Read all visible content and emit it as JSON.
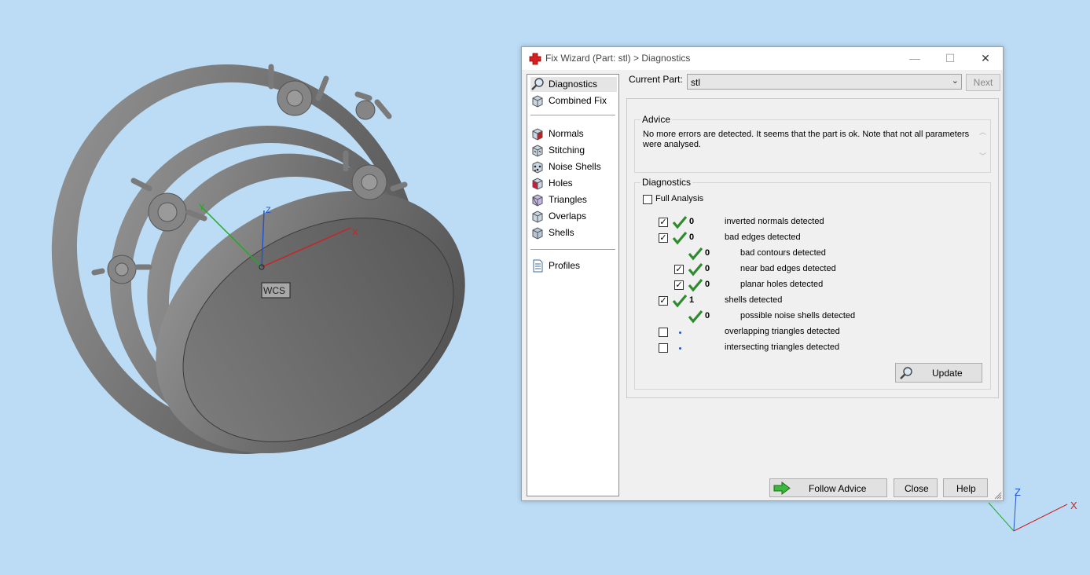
{
  "viewport": {
    "wcs_label": "WCS",
    "axis_x": "X",
    "axis_y": "Y",
    "axis_z": "Z"
  },
  "colors": {
    "background": "#bcdcf6",
    "check_green": "#2e8b2e",
    "axis_x": "#cc2222",
    "axis_y": "#22aa22",
    "axis_z": "#2255cc"
  },
  "dialog": {
    "title": "Fix Wizard (Part: stl) > Diagnostics",
    "title_icon": "red-cross-icon",
    "window_controls": {
      "minimize": "—",
      "maximize": "☐",
      "close": "✕"
    },
    "nav": {
      "top_items": [
        {
          "label": "Diagnostics",
          "icon": "magnifier-icon"
        },
        {
          "label": "Combined Fix",
          "icon": "cube-icon"
        }
      ],
      "fix_items": [
        {
          "label": "Normals",
          "icon": "normals-cube-icon"
        },
        {
          "label": "Stitching",
          "icon": "stitching-cube-icon"
        },
        {
          "label": "Noise Shells",
          "icon": "noise-shells-icon"
        },
        {
          "label": "Holes",
          "icon": "holes-cube-icon"
        },
        {
          "label": "Triangles",
          "icon": "triangles-cube-icon"
        },
        {
          "label": "Overlaps",
          "icon": "overlaps-cube-icon"
        },
        {
          "label": "Shells",
          "icon": "shells-cube-icon"
        }
      ],
      "bottom_items": [
        {
          "label": "Profiles",
          "icon": "document-icon"
        }
      ]
    },
    "current_part": {
      "label": "Current Part:",
      "value": "stl"
    },
    "next_label": "Next",
    "advice": {
      "title": "Advice",
      "text": "No more errors are detected. It seems that the part is ok. Note that not all parameters were analysed."
    },
    "diagnostics": {
      "title": "Diagnostics",
      "full_analysis": "Full Analysis",
      "rows": [
        {
          "checked": true,
          "status": "ok",
          "value": "0",
          "label": "inverted normals detected"
        },
        {
          "checked": true,
          "status": "ok",
          "value": "0",
          "label": "bad edges detected"
        },
        {
          "checked": null,
          "status": "ok",
          "value": "0",
          "label": "bad contours detected"
        },
        {
          "checked": true,
          "status": "ok",
          "value": "0",
          "label": "near bad edges detected"
        },
        {
          "checked": true,
          "status": "ok",
          "value": "0",
          "label": "planar holes detected"
        },
        {
          "checked": true,
          "status": "ok",
          "value": "1",
          "label": "shells detected"
        },
        {
          "checked": null,
          "status": "ok",
          "value": "0",
          "label": "possible noise shells detected"
        },
        {
          "checked": false,
          "status": "pending",
          "value": "",
          "label": "overlapping triangles detected"
        },
        {
          "checked": false,
          "status": "pending",
          "value": "",
          "label": "intersecting triangles detected"
        }
      ],
      "update_label": "Update"
    },
    "buttons": {
      "follow_advice": "Follow Advice",
      "close": "Close",
      "help": "Help"
    }
  }
}
